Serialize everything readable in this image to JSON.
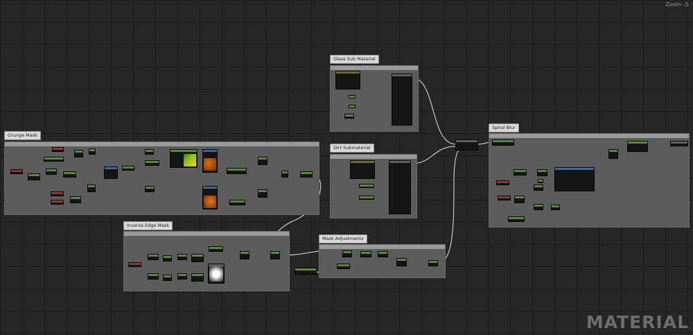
{
  "canvas": {
    "zoom_label": "Zoom -5",
    "watermark": "MATERIAL"
  },
  "colors": {
    "background": "#262626",
    "comment_box": "#5c5c5c",
    "comment_title": "#d9d9d9",
    "node_body": "#151515",
    "wire": "#e6e6e6",
    "header_green": "#5c8a3c",
    "header_red": "#a43030",
    "header_blue": "#3f6a9a",
    "header_olive": "#6e6a36"
  },
  "comments": {
    "glass_sub_material": {
      "title": "Glass Sub Material"
    },
    "dirt_submaterial": {
      "title": "Dirt Submaterial"
    },
    "grunge_mask": {
      "title": "Grunge Mask"
    },
    "inverse_edge_mask": {
      "title": "Inverse Edge Mask"
    },
    "mask_adjustments": {
      "title": "Mask Adjustments"
    },
    "spiral_blur": {
      "title": "Spiral Blur"
    }
  }
}
